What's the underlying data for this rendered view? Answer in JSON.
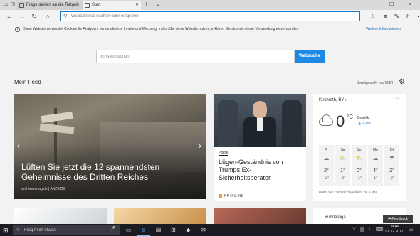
{
  "tabs": [
    {
      "title": "Frage stellen an die Ratgeb",
      "icon": "page-icon"
    },
    {
      "title": "Start",
      "icon": "page-icon"
    }
  ],
  "address_bar": {
    "placeholder": "Webadresse suchen oder eingeben"
  },
  "cookie_notice": {
    "text": "Diese Website verwendet Cookies für Analysen, personalisierte Inhalte und Werbung. Indem Sie diese Website nutzen, erklären Sie sich mit dieser Verwendung einverstanden.",
    "link": "Weitere Informationen"
  },
  "search": {
    "placeholder": "Im Web suchen",
    "button": "Websuche"
  },
  "feed": {
    "title": "Mein Feed",
    "provided_by": "Bereitgestellt von MSN"
  },
  "hero": {
    "title": "Lüften Sie jetzt die 12 spannendsten Geheimnisse des Dritten Reiches",
    "source": "archiveverlag.de | ANZEIGE",
    "dots": 10,
    "active_dot": 4
  },
  "card2": {
    "category": "Politik",
    "title": "Lügen-Geständnis von Trumps Ex-Sicherheitsberater",
    "source": "RP ONLINE"
  },
  "weather": {
    "location": "Kirchroth, BY",
    "temp": "0",
    "unit": "°C",
    "condition": "Bewölkt",
    "precip": "0,0%",
    "days": [
      {
        "name": "Fr",
        "hi": "2°",
        "lo": "-2°",
        "icon": "cloud-icon"
      },
      {
        "name": "Sa",
        "hi": "1°",
        "lo": "-3°",
        "icon": "sun-cloud-icon"
      },
      {
        "name": "So",
        "hi": "0°",
        "lo": "-1°",
        "icon": "sun-cloud-icon"
      },
      {
        "name": "Mo",
        "hi": "4°",
        "lo": "1°",
        "icon": "snow-cloud-icon"
      },
      {
        "name": "Di",
        "hi": "2°",
        "lo": "-3°",
        "icon": "rain-cloud-icon"
      }
    ],
    "footer": "Daten von Foreca | Aktualisiert vor 4 Min."
  },
  "bundesliga": "Bundesliga",
  "feedback": "Feedback",
  "taskbar": {
    "search_placeholder": "Frag mich etwas",
    "time": "19:46",
    "date": "01.12.2017"
  }
}
